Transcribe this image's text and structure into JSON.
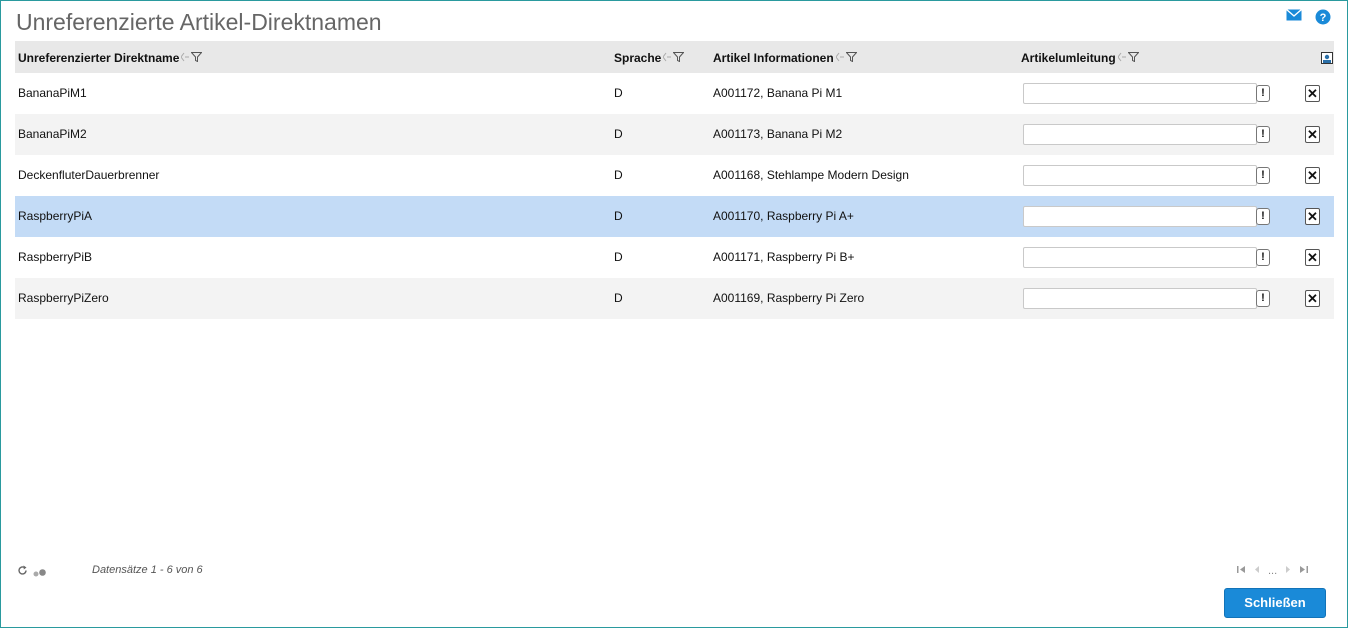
{
  "title": "Unreferenzierte Artikel-Direktnamen",
  "icons": {
    "mail": "mail-icon",
    "help": "help-icon"
  },
  "columns": {
    "direktname": "Unreferenzierter Direktname",
    "sprache": "Sprache",
    "artikel": "Artikel Informationen",
    "umleitung": "Artikelumleitung"
  },
  "rows": [
    {
      "name": "BananaPiM1",
      "lang": "D",
      "info": "A001172, Banana Pi M1",
      "redirect": ""
    },
    {
      "name": "BananaPiM2",
      "lang": "D",
      "info": "A001173, Banana Pi M2",
      "redirect": ""
    },
    {
      "name": "DeckenfluterDauerbrenner",
      "lang": "D",
      "info": "A001168, Stehlampe Modern Design",
      "redirect": ""
    },
    {
      "name": "RaspberryPiA",
      "lang": "D",
      "info": "A001170, Raspberry Pi A+",
      "redirect": ""
    },
    {
      "name": "RaspberryPiB",
      "lang": "D",
      "info": "A001171, Raspberry Pi B+",
      "redirect": ""
    },
    {
      "name": "RaspberryPiZero",
      "lang": "D",
      "info": "A001169, Raspberry Pi Zero",
      "redirect": ""
    }
  ],
  "selected_row": 3,
  "row_actions": {
    "exclaim": "!",
    "delete": "✕"
  },
  "footer": {
    "records": "Datensätze 1 - 6 von 6",
    "pager_ellipsis": "..."
  },
  "close_label": "Schließen",
  "colors": {
    "accent": "#1a8ad8",
    "selection": "#c3dbf6",
    "header": "#e8e8e8"
  }
}
